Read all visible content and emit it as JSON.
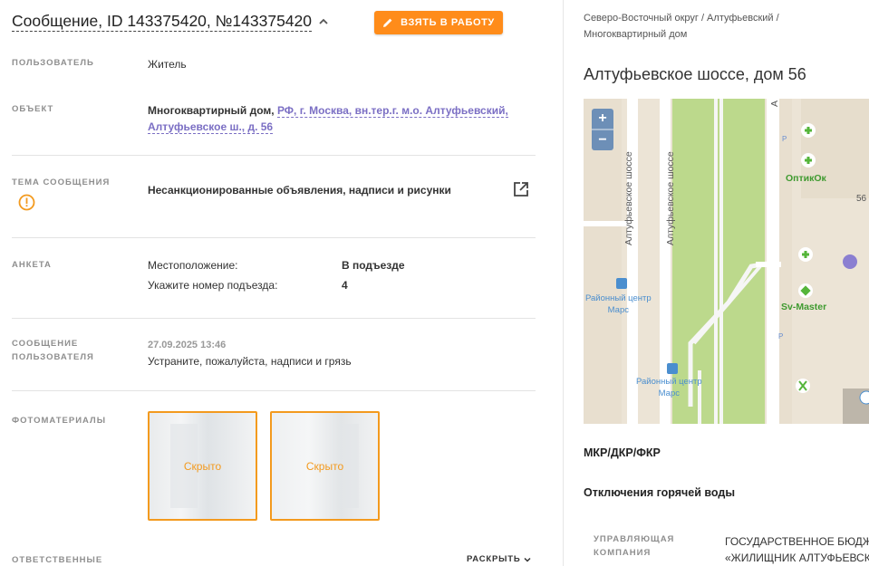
{
  "header": {
    "title": "Сообщение, ID 143375420, №143375420",
    "take_button": "ВЗЯТЬ В РАБОТУ"
  },
  "fields": {
    "user": {
      "label": "ПОЛЬЗОВАТЕЛЬ",
      "value": "Житель"
    },
    "object": {
      "label": "ОБЪЕКТ",
      "type": "Многоквартирный дом,",
      "link_line1": "РФ, г. Москва, вн.тер.г. м.о. Алтуфьевский,",
      "link_line2": "Алтуфьевское ш., д. 56"
    },
    "topic": {
      "label": "ТЕМА СООБЩЕНИЯ",
      "value": "Несанкционированные объявления, надписи и рисунки"
    },
    "survey": {
      "label": "АНКЕТА",
      "rows": [
        {
          "key": "Местоположение:",
          "value": "В подъезде"
        },
        {
          "key": "Укажите номер подъезда:",
          "value": "4"
        }
      ]
    },
    "message": {
      "label_line1": "СООБЩЕНИЕ",
      "label_line2": "ПОЛЬЗОВАТЕЛЯ",
      "datetime": "27.09.2025 13:46",
      "text": "Устраните, пожалуйста, надписи и грязь"
    },
    "photos": {
      "label": "ФОТОМАТЕРИАЛЫ",
      "items": [
        "Скрыто",
        "Скрыто"
      ]
    },
    "responsible": {
      "label": "ОТВЕТСТВЕННЫЕ",
      "expand": "РАСКРЫТЬ"
    }
  },
  "right": {
    "breadcrumb_line1": "Северо-Восточный округ / Алтуфьевский /",
    "breadcrumb_line2": "Многоквартирный дом",
    "address": "Алтуфьевское шоссе, дом 56",
    "map": {
      "zoom_in": "+",
      "zoom_out": "−",
      "street1": "Алтуфьевское шоссе",
      "street2": "Алтуфьевское шоссе",
      "street3": "А",
      "poi_optic": "ОптикОк",
      "poi_svmaster": "Sv-Master",
      "bus1_line1": "Районный центр",
      "bus1_line2": "Марс",
      "bus2_line1": "Районный центр",
      "bus2_line2": "Марс",
      "house_no": "56",
      "parking": "P"
    },
    "section1": "МКР/ДКР/ФКР",
    "section2": "Отключения горячей воды",
    "mc": {
      "label_line1": "УПРАВЛЯЮЩАЯ",
      "label_line2": "КОМПАНИЯ",
      "value_line1": "ГОСУДАРСТВЕННОЕ БЮДЖ",
      "value_line2": "«ЖИЛИЩНИК АЛТУФЬЕВСК"
    }
  },
  "colors": {
    "accent": "#ff8c1a",
    "link": "#7b6fc4",
    "label": "#8e8e8e",
    "map_green": "#bcd98c"
  }
}
